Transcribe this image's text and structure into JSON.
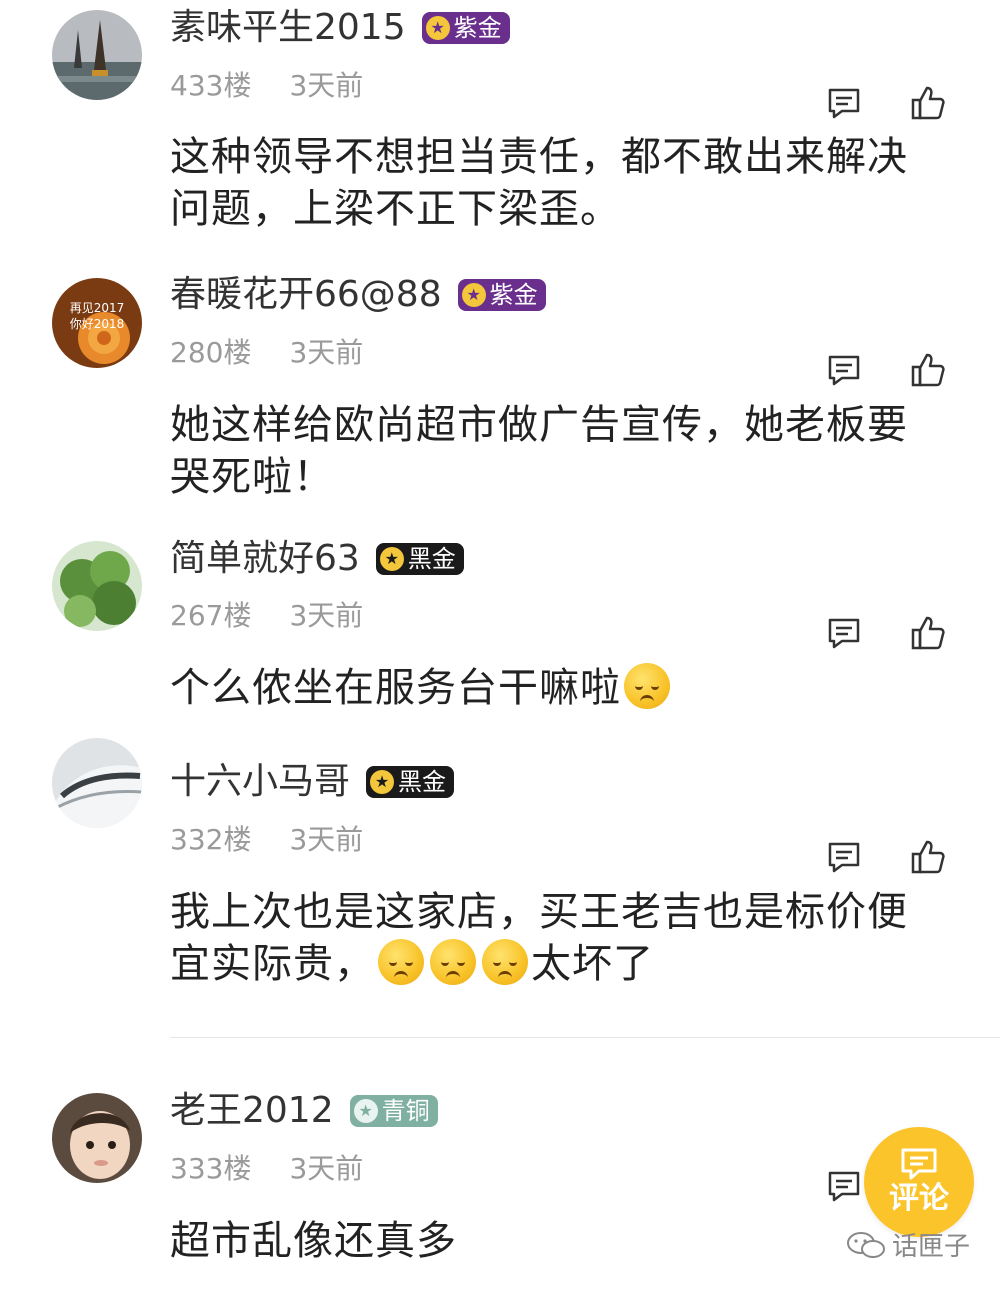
{
  "comments": [
    {
      "username": "素味平生2015",
      "badge": {
        "label": "紫金",
        "style": "purple"
      },
      "floor": "433楼",
      "time": "3天前",
      "text": "这种领导不想担当责任，都不敢出来解决问题，上梁不正下梁歪。",
      "avatar": {
        "icon": "pagoda-lake-avatar"
      }
    },
    {
      "username": "春暖花开66@88",
      "badge": {
        "label": "紫金",
        "style": "purple"
      },
      "floor": "280楼",
      "time": "3天前",
      "text": "她这样给欧尚超市做广告宣传，她老板要哭死啦！",
      "avatar": {
        "icon": "rose-avatar",
        "line1": "再见2017",
        "line2": "你好2018"
      }
    },
    {
      "username": "简单就好63",
      "badge": {
        "label": "黑金",
        "style": "black"
      },
      "floor": "267楼",
      "time": "3天前",
      "text": "个么侬坐在服务台干嘛啦",
      "emoji_count": 1,
      "avatar": {
        "icon": "green-plant-avatar"
      }
    },
    {
      "username": "十六小马哥",
      "badge": {
        "label": "黑金",
        "style": "black"
      },
      "floor": "332楼",
      "time": "3天前",
      "text_before": "我上次也是这家店，买王老吉也是标价便宜实际贵，",
      "text_after": "太坏了",
      "emoji_count": 3,
      "avatar": {
        "icon": "bullet-train-avatar"
      }
    },
    {
      "username": "老王2012",
      "badge": {
        "label": "青铜",
        "style": "green"
      },
      "floor": "333楼",
      "time": "3天前",
      "text": "超市乱像还真多",
      "avatar": {
        "icon": "baby-avatar"
      }
    }
  ],
  "fab": {
    "label": "评论",
    "icon": "comment-icon",
    "color": "#fcc42b"
  },
  "watermark": {
    "text": "话匣子",
    "icon": "wechat-icon"
  },
  "colors": {
    "purple_badge": "#6a2f8c",
    "black_badge": "#1a1a1a",
    "bronze_badge": "#7fb0a2",
    "meta_text": "#9a9a9a"
  }
}
